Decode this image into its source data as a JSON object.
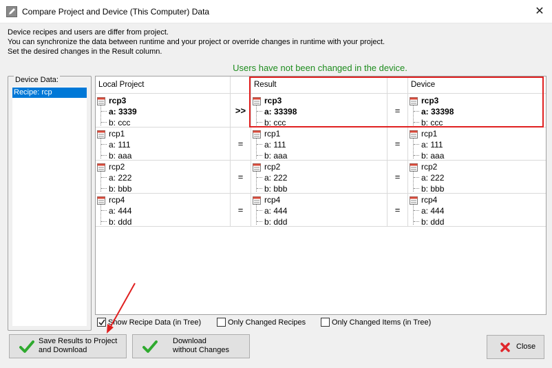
{
  "window": {
    "title": "Compare Project and Device (This Computer) Data",
    "close_glyph": "✕"
  },
  "intro": {
    "line1": "Device recipes and users are differ from project.",
    "line2": "You can synchronize the data between runtime and your project or override changes in runtime with your project.",
    "line3": "Set the desired changes in the Result column."
  },
  "status": "Users have not been changed in the device.",
  "device_panel": {
    "legend": "Device Data:",
    "items": [
      "Recipe: rcp"
    ]
  },
  "grid": {
    "headers": {
      "local": "Local Project",
      "result": "Result",
      "device": "Device"
    },
    "rows": [
      {
        "op1": ">>",
        "op2": "=",
        "local": {
          "name": "rcp3",
          "a": "a: 3339",
          "b": "b: ccc"
        },
        "result": {
          "name": "rcp3",
          "a": "a: 33398",
          "b": "b: ccc"
        },
        "device": {
          "name": "rcp3",
          "a": "a: 33398",
          "b": "b: ccc"
        }
      },
      {
        "op1": "=",
        "op2": "=",
        "local": {
          "name": "rcp1",
          "a": "a: 111",
          "b": "b: aaa"
        },
        "result": {
          "name": "rcp1",
          "a": "a: 111",
          "b": "b: aaa"
        },
        "device": {
          "name": "rcp1",
          "a": "a: 111",
          "b": "b: aaa"
        }
      },
      {
        "op1": "=",
        "op2": "=",
        "local": {
          "name": "rcp2",
          "a": "a: 222",
          "b": "b: bbb"
        },
        "result": {
          "name": "rcp2",
          "a": "a: 222",
          "b": "b: bbb"
        },
        "device": {
          "name": "rcp2",
          "a": "a: 222",
          "b": "b: bbb"
        }
      },
      {
        "op1": "=",
        "op2": "=",
        "local": {
          "name": "rcp4",
          "a": "a: 444",
          "b": "b: ddd"
        },
        "result": {
          "name": "rcp4",
          "a": "a: 444",
          "b": "b: ddd"
        },
        "device": {
          "name": "rcp4",
          "a": "a: 444",
          "b": "b: ddd"
        }
      }
    ]
  },
  "options": {
    "show_recipe_data": {
      "label": "Show Recipe Data (in Tree)",
      "checked": true
    },
    "only_changed_recipes": {
      "label": "Only Changed Recipes",
      "checked": false
    },
    "only_changed_items": {
      "label": "Only Changed Items (in Tree)",
      "checked": false
    }
  },
  "buttons": {
    "save_download": {
      "line1": "Save Results to Project",
      "line2": "and Download"
    },
    "download_no_changes": {
      "line1": "Download",
      "line2": "without Changes"
    },
    "close": {
      "label": "Close"
    }
  },
  "colors": {
    "status_green": "#1e8c1e",
    "selection_blue": "#0078d7",
    "highlight_red": "#e02020",
    "check_green": "#2faa2f",
    "close_red": "#e0262b"
  }
}
